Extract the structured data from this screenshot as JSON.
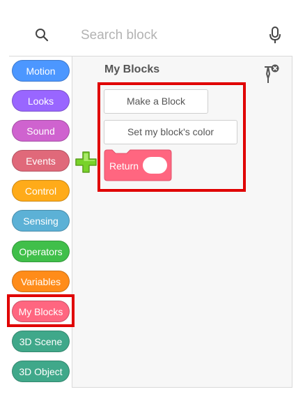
{
  "search": {
    "placeholder": "Search block"
  },
  "categories": [
    {
      "label": "Motion",
      "color": "#4c97ff"
    },
    {
      "label": "Looks",
      "color": "#9966ff"
    },
    {
      "label": "Sound",
      "color": "#cf63cf"
    },
    {
      "label": "Events",
      "color": "#e0697a"
    },
    {
      "label": "Control",
      "color": "#ffab19"
    },
    {
      "label": "Sensing",
      "color": "#5cb1d6"
    },
    {
      "label": "Operators",
      "color": "#40bf4a"
    },
    {
      "label": "Variables",
      "color": "#ff8c1a"
    },
    {
      "label": "My Blocks",
      "color": "#ff6680"
    },
    {
      "label": "3D Scene",
      "color": "#40a88a"
    },
    {
      "label": "3D Object",
      "color": "#40a88a"
    }
  ],
  "selected_category": "My Blocks",
  "panel": {
    "title": "My Blocks",
    "make_block_label": "Make a Block",
    "set_color_label": "Set my block's color",
    "return_label": "Return"
  },
  "colors": {
    "highlight": "#e00000",
    "myblocks": "#ff6680",
    "plus": "#78d22a"
  }
}
